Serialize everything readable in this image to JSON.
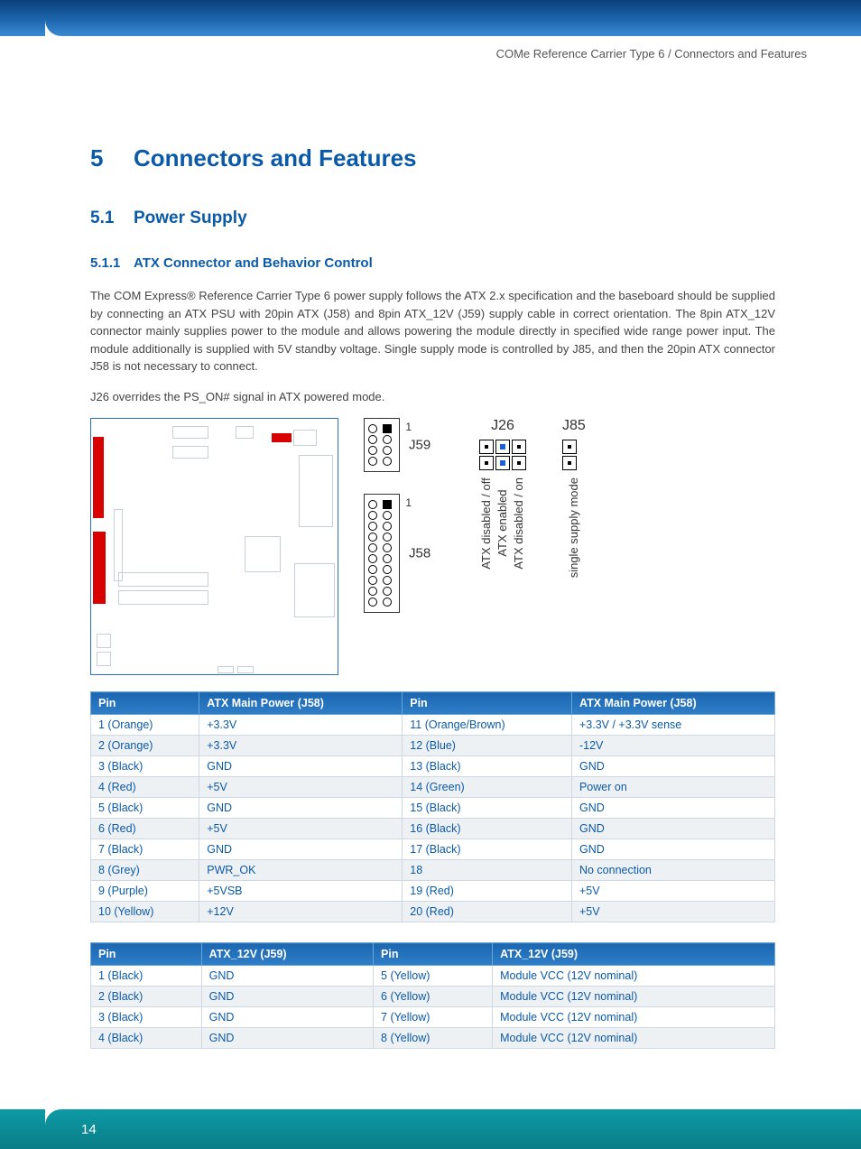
{
  "header": {
    "breadcrumb": "COMe Reference Carrier Type 6 / Connectors and Features"
  },
  "chapter": {
    "num": "5",
    "title": "Connectors and Features"
  },
  "section": {
    "num": "5.1",
    "title": "Power Supply"
  },
  "subsection": {
    "num": "5.1.1",
    "title": "ATX Connector and Behavior Control"
  },
  "paragraphs": {
    "p1": "The COM Express® Reference Carrier Type 6 power supply follows the ATX 2.x specification and the baseboard should be supplied by connecting an ATX PSU with 20pin ATX (J58) and 8pin ATX_12V (J59) supply cable in correct orientation. The 8pin ATX_12V connector mainly supplies power to the module and allows powering the module directly in specified wide range power input. The module additionally is supplied with 5V standby voltage. Single supply mode is controlled by J85, and then the 20pin ATX connector J58 is not necessary to connect.",
    "p2": "J26 overrides the PS_ON# signal in ATX powered mode."
  },
  "connectors": {
    "j59": "J59",
    "j58": "J58",
    "pin1": "1"
  },
  "jumpers": {
    "j26": "J26",
    "j85": "J85",
    "j26_labels": [
      "ATX disabled / off",
      "ATX enabled",
      "ATX disabled / on"
    ],
    "j85_label": "single supply mode"
  },
  "table1": {
    "headers": [
      "Pin",
      "ATX Main Power (J58)",
      "Pin",
      "ATX Main Power (J58)"
    ],
    "rows": [
      [
        "1 (Orange)",
        "+3.3V",
        "11 (Orange/Brown)",
        "+3.3V / +3.3V sense"
      ],
      [
        "2 (Orange)",
        "+3.3V",
        "12 (Blue)",
        "-12V"
      ],
      [
        "3 (Black)",
        "GND",
        "13 (Black)",
        "GND"
      ],
      [
        "4 (Red)",
        "+5V",
        "14 (Green)",
        "Power on"
      ],
      [
        "5 (Black)",
        "GND",
        "15 (Black)",
        "GND"
      ],
      [
        "6 (Red)",
        "+5V",
        "16 (Black)",
        "GND"
      ],
      [
        "7 (Black)",
        "GND",
        "17 (Black)",
        "GND"
      ],
      [
        "8 (Grey)",
        "PWR_OK",
        "18",
        "No connection"
      ],
      [
        "9 (Purple)",
        "+5VSB",
        "19 (Red)",
        "+5V"
      ],
      [
        "10 (Yellow)",
        "+12V",
        "20 (Red)",
        "+5V"
      ]
    ]
  },
  "table2": {
    "headers": [
      "Pin",
      "ATX_12V (J59)",
      "Pin",
      "ATX_12V (J59)"
    ],
    "rows": [
      [
        "1 (Black)",
        "GND",
        "5 (Yellow)",
        "Module VCC (12V nominal)"
      ],
      [
        "2 (Black)",
        "GND",
        "6 (Yellow)",
        "Module VCC (12V nominal)"
      ],
      [
        "3 (Black)",
        "GND",
        "7 (Yellow)",
        "Module VCC (12V nominal)"
      ],
      [
        "4 (Black)",
        "GND",
        "8 (Yellow)",
        "Module VCC (12V nominal)"
      ]
    ]
  },
  "footer": {
    "page": "14"
  }
}
